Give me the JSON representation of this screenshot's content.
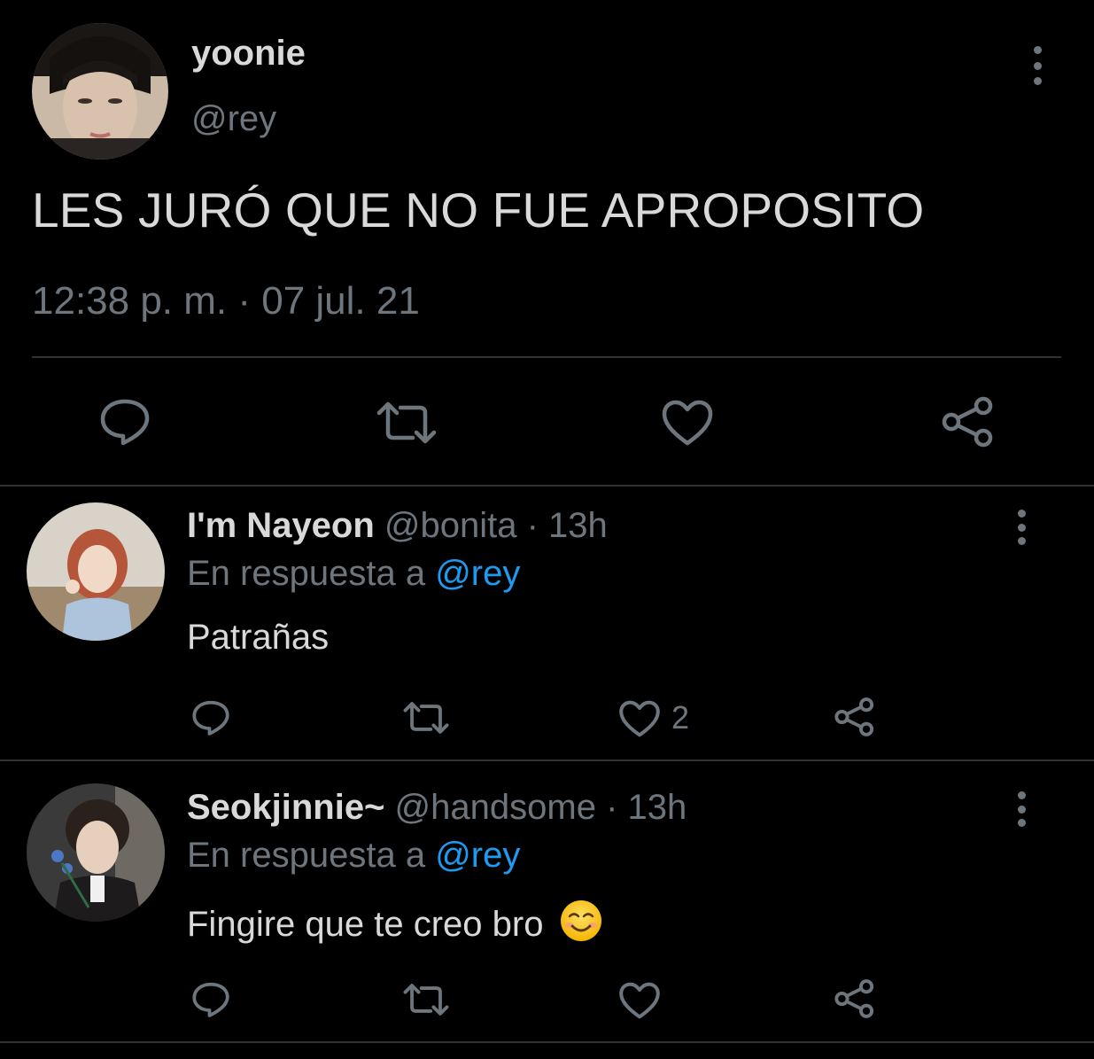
{
  "tweet": {
    "display_name": "yoonie",
    "handle": "@rey",
    "text": "LES JURÓ QUE NO FUE APROPOSITO",
    "timestamp": "12:38 p. m. · 07 jul. 21",
    "actions": [
      "reply-icon",
      "retweet-icon",
      "like-icon",
      "share-icon"
    ]
  },
  "replies": [
    {
      "display_name": "I'm Nayeon",
      "meta": "@bonita · 13h",
      "reply_prefix": "En respuesta a",
      "reply_mention": "@rey",
      "text": "Patrañas",
      "like_count": "2"
    },
    {
      "display_name": "Seokjinnie~",
      "meta": "@handsome · 13h",
      "reply_prefix": "En respuesta a",
      "reply_mention": "@rey",
      "text": "Fingire que te creo bro",
      "emoji": "smiling-face-emoji"
    }
  ],
  "colors": {
    "background": "#000000",
    "text_primary": "#d9d9d9",
    "text_secondary": "#6e767d",
    "link": "#1d9bf0",
    "divider": "#2f3336"
  }
}
